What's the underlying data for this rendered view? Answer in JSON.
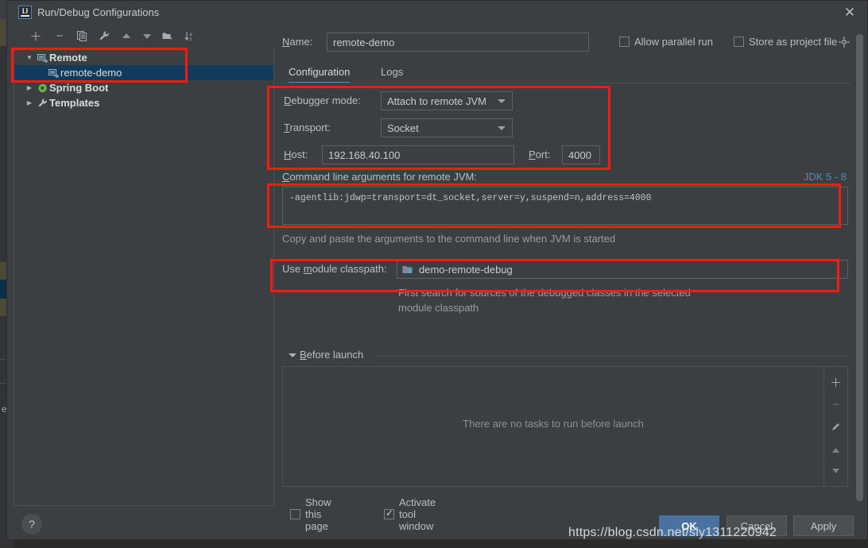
{
  "window": {
    "title": "Run/Debug Configurations",
    "app_icon": "intellij-idea-icon",
    "close_label": "✕"
  },
  "tree_toolbar": {
    "buttons": [
      {
        "name": "add-configuration-button",
        "glyph": "+"
      },
      {
        "name": "remove-configuration-button",
        "glyph": "−"
      },
      {
        "name": "copy-configuration-button",
        "glyph": "copy-icon"
      },
      {
        "name": "edit-templates-button",
        "glyph": "wrench-icon"
      },
      {
        "name": "move-up-button",
        "glyph": "arrow-up-icon"
      },
      {
        "name": "move-down-button",
        "glyph": "arrow-down-icon"
      },
      {
        "name": "create-folder-button",
        "glyph": "folder-add-icon"
      },
      {
        "name": "sort-configurations-button",
        "glyph": "sort-az-icon"
      }
    ]
  },
  "tree": {
    "items": [
      {
        "label": "Remote",
        "icon": "remote-icon",
        "level": 0,
        "expanded": true,
        "selected": false,
        "twisty": "▼"
      },
      {
        "label": "remote-demo",
        "icon": "remote-icon",
        "level": 1,
        "expanded": false,
        "selected": true,
        "twisty": ""
      },
      {
        "label": "Spring Boot",
        "icon": "spring-boot-icon",
        "level": 0,
        "expanded": false,
        "selected": false,
        "twisty": "▶"
      },
      {
        "label": "Templates",
        "icon": "wrench-icon",
        "level": 0,
        "expanded": false,
        "selected": false,
        "twisty": "▶"
      }
    ]
  },
  "header": {
    "name_label": "Name:",
    "name_value": "remote-demo",
    "name_placeholder": "",
    "allow_parallel_run_label": "Allow parallel run",
    "allow_parallel_run_checked": false,
    "store_as_project_file_label": "Store as project file",
    "store_as_project_file_checked": false,
    "gear_icon": "gear-icon"
  },
  "tabs": [
    {
      "label": "Configuration",
      "active": true
    },
    {
      "label": "Logs",
      "active": false
    }
  ],
  "configuration": {
    "debugger_mode_label": "Debugger mode:",
    "debugger_mode_value": "Attach to remote JVM",
    "transport_label": "Transport:",
    "transport_value": "Socket",
    "host_label": "Host:",
    "host_value": "192.168.40.100",
    "port_label": "Port:",
    "port_value": "4000",
    "cmdline_label": "Command line arguments for remote JVM:",
    "jdk_hint": "JDK 5 - 8",
    "cmdline_value": "-agentlib:jdwp=transport=dt_socket,server=y,suspend=n,address=4000",
    "cmdline_hint": "Copy and paste the arguments to the command line when JVM is started",
    "module_classpath_label": "Use module classpath:",
    "module_classpath_value": "demo-remote-debug",
    "module_classpath_icon": "module-icon",
    "module_classpath_hint": "First search for sources of the debugged classes in the selected module classpath"
  },
  "before_launch": {
    "title": "Before launch",
    "expanded": true,
    "empty_text": "There are no tasks to run before launch",
    "side_buttons": [
      {
        "name": "add-task-button",
        "glyph": "+"
      },
      {
        "name": "remove-task-button",
        "glyph": "−"
      },
      {
        "name": "edit-task-button",
        "glyph": "pencil-icon"
      },
      {
        "name": "move-task-up-button",
        "glyph": "▲"
      },
      {
        "name": "move-task-down-button",
        "glyph": "▼"
      }
    ],
    "show_this_page_label": "Show this page",
    "show_this_page_checked": false,
    "activate_tool_window_label": "Activate tool window",
    "activate_tool_window_checked": true
  },
  "footer": {
    "help_label": "?",
    "ok_label": "OK",
    "cancel_label": "Cancel",
    "apply_label": "Apply"
  },
  "watermark": "https://blog.csdn.net/sly1311220942",
  "ide_backdrop_letter": "e",
  "colors": {
    "dialog_bg": "#3c3f41",
    "selection_blue": "#113a5c",
    "accent_blue": "#4a88c7",
    "annotation_red": "#ff1a0d",
    "ok_button": "#4a72a0",
    "link_blue": "#5c86b5"
  }
}
